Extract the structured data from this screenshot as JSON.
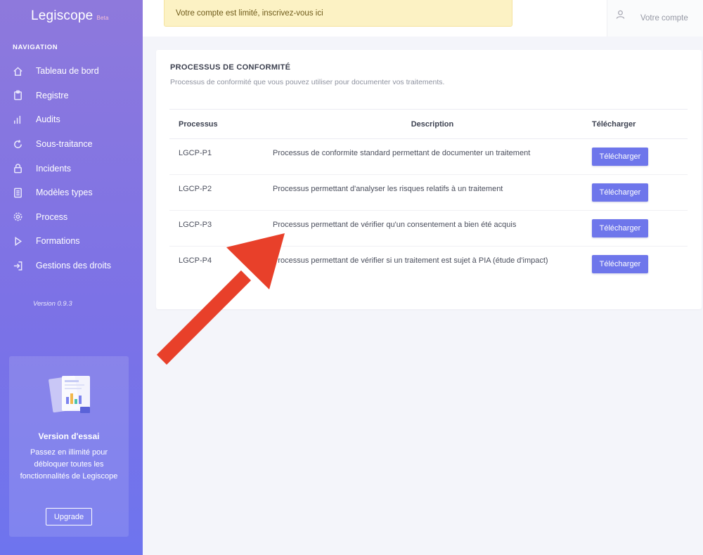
{
  "sidebar": {
    "brand": "Legiscope",
    "brand_badge": "Beta",
    "nav_heading": "NAVIGATION",
    "items": [
      {
        "label": "Tableau de bord",
        "icon": "home-icon"
      },
      {
        "label": "Registre",
        "icon": "clipboard-icon"
      },
      {
        "label": "Audits",
        "icon": "bar-chart-icon"
      },
      {
        "label": "Sous-traitance",
        "icon": "refresh-icon"
      },
      {
        "label": "Incidents",
        "icon": "lock-icon"
      },
      {
        "label": "Modèles types",
        "icon": "document-icon"
      },
      {
        "label": "Process",
        "icon": "gear-icon"
      },
      {
        "label": "Formations",
        "icon": "play-icon"
      },
      {
        "label": "Gestions des droits",
        "icon": "sign-in-icon"
      }
    ],
    "version": "Version 0.9.3",
    "trial": {
      "title": "Version d'essai",
      "text": "Passez en illimité pour débloquer toutes les fonctionnalités de Legiscope",
      "button": "Upgrade"
    }
  },
  "topbar": {
    "alert": "Votre compte est limité, inscrivez-vous ici",
    "account": "Votre compte"
  },
  "main": {
    "title": "PROCESSUS DE CONFORMITÉ",
    "subtitle": "Processus de conformité que vous pouvez utiliser pour documenter vos traitements.",
    "table": {
      "headers": [
        "Processus",
        "Description",
        "Télécharger"
      ],
      "rows": [
        {
          "processus": "LGCP-P1",
          "description": "Processus de conformite standard permettant de documenter un traitement",
          "action": "Télécharger"
        },
        {
          "processus": "LGCP-P2",
          "description": "Processus permettant d'analyser les risques relatifs à un traitement",
          "action": "Télécharger"
        },
        {
          "processus": "LGCP-P3",
          "description": "Processus permettant de vérifier qu'un consentement a bien été acquis",
          "action": "Télécharger"
        },
        {
          "processus": "LGCP-P4",
          "description": "Processus permettant de vérifier si un traitement est sujet à PIA (étude d'impact)",
          "action": "Télécharger"
        }
      ]
    }
  },
  "colors": {
    "sidebar_top": "#8e79dc",
    "sidebar_bottom": "#6e74ee",
    "button": "#6e76eb",
    "alert_bg": "#fcf2c4",
    "arrow": "#e8402a"
  }
}
